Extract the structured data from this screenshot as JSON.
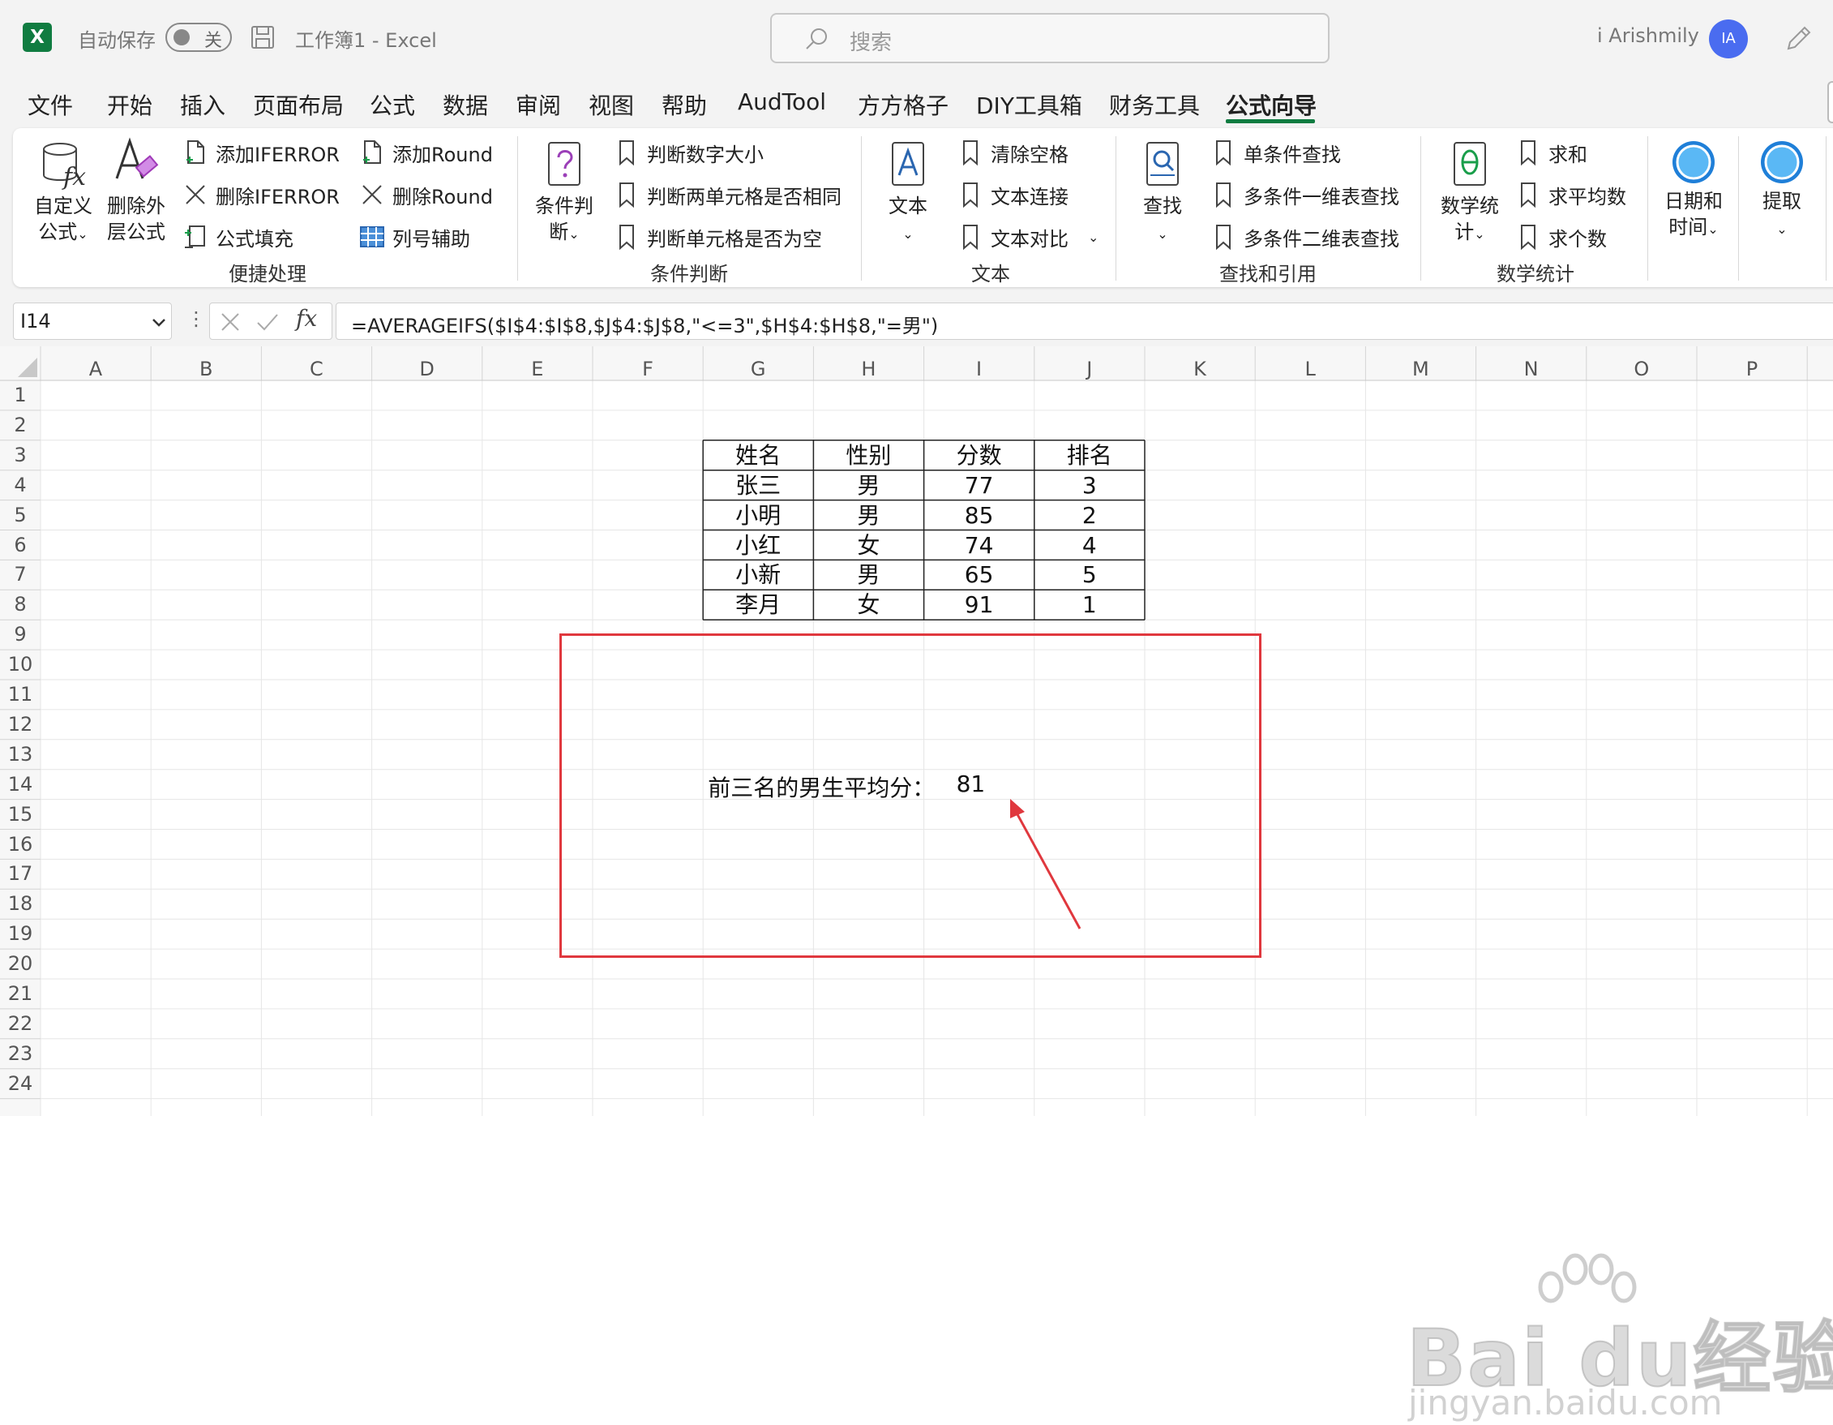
{
  "titlebar": {
    "app_logo": "X",
    "autosave_label": "自动保存",
    "autosave_state": "关",
    "doc_title": "工作簿1  -  Excel",
    "search_placeholder": "搜索",
    "user_name": "i Arishmily",
    "avatar_initials": "IA"
  },
  "menu": {
    "tabs": [
      {
        "label": "文件"
      },
      {
        "label": "开始"
      },
      {
        "label": "插入"
      },
      {
        "label": "页面布局"
      },
      {
        "label": "公式"
      },
      {
        "label": "数据"
      },
      {
        "label": "审阅"
      },
      {
        "label": "视图"
      },
      {
        "label": "帮助"
      },
      {
        "label": "AudTool"
      },
      {
        "label": "方方格子"
      },
      {
        "label": "DIY工具箱"
      },
      {
        "label": "财务工具"
      },
      {
        "label": "公式向导"
      }
    ],
    "active": "公式向导"
  },
  "ribbon": {
    "groups": {
      "quick": {
        "label": "便捷处理",
        "custom_formula": "自定义\n公式",
        "remove_outer": "删除外\n层公式",
        "add_iferror": "添加IFERROR",
        "remove_iferror": "删除IFERROR",
        "formula_fill": "公式填充",
        "add_round": "添加Round",
        "remove_round": "删除Round",
        "col_helper": "列号辅助"
      },
      "cond": {
        "label": "条件判断",
        "big": "条件判\n断",
        "num_size": "判断数字大小",
        "two_same": "判断两单元格是否相同",
        "is_empty": "判断单元格是否为空"
      },
      "text": {
        "label": "文本",
        "big": "文本",
        "trim": "清除空格",
        "concat": "文本连接",
        "compare": "文本对比"
      },
      "lookup": {
        "label": "查找和引用",
        "big": "查找",
        "single": "单条件查找",
        "multi_1d": "多条件一维表查找",
        "multi_2d": "多条件二维表查找"
      },
      "math": {
        "label": "数学统计",
        "big": "数学统\n计",
        "sum": "求和",
        "avg": "求平均数",
        "count": "求个数"
      },
      "date": {
        "big": "日期和\n时间"
      },
      "extract": {
        "big": "提取"
      }
    }
  },
  "formula_bar": {
    "name_box": "I14",
    "formula": "=AVERAGEIFS($I$4:$I$8,$J$4:$J$8,\"<=3\",$H$4:$H$8,\"=男\")"
  },
  "grid": {
    "columns": [
      "A",
      "B",
      "C",
      "D",
      "E",
      "F",
      "G",
      "H",
      "I",
      "J",
      "K",
      "L",
      "M",
      "N",
      "O",
      "P"
    ],
    "rows": [
      "1",
      "2",
      "3",
      "4",
      "5",
      "6",
      "7",
      "8",
      "9",
      "10",
      "11",
      "12",
      "13",
      "14",
      "15",
      "16",
      "17",
      "18",
      "19",
      "20",
      "21",
      "22",
      "23",
      "24"
    ],
    "table": {
      "headers": [
        "姓名",
        "性别",
        "分数",
        "排名"
      ],
      "rows": [
        [
          "张三",
          "男",
          "77",
          "3"
        ],
        [
          "小明",
          "男",
          "85",
          "2"
        ],
        [
          "小红",
          "女",
          "74",
          "4"
        ],
        [
          "小新",
          "男",
          "65",
          "5"
        ],
        [
          "李月",
          "女",
          "91",
          "1"
        ]
      ]
    },
    "result_label": "前三名的男生平均分：",
    "result_value": "81"
  },
  "colors": {
    "excel_green": "#107c41",
    "highlight_red": "#e0383e",
    "avatar_blue": "#4a6cf0"
  },
  "watermark": {
    "brand": "Bai  du经验",
    "url": "jingyan.baidu.com"
  }
}
